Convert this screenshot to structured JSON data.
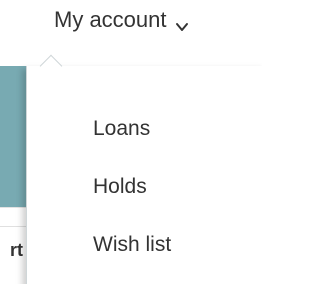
{
  "header": {
    "account_label": "My account",
    "chevron_icon": "chevron-down-icon"
  },
  "dropdown": {
    "items": [
      {
        "label": "Loans"
      },
      {
        "label": "Holds"
      },
      {
        "label": "Wish list"
      }
    ]
  },
  "background": {
    "fragment_text": "rt",
    "accent_color": "#78aab2"
  }
}
